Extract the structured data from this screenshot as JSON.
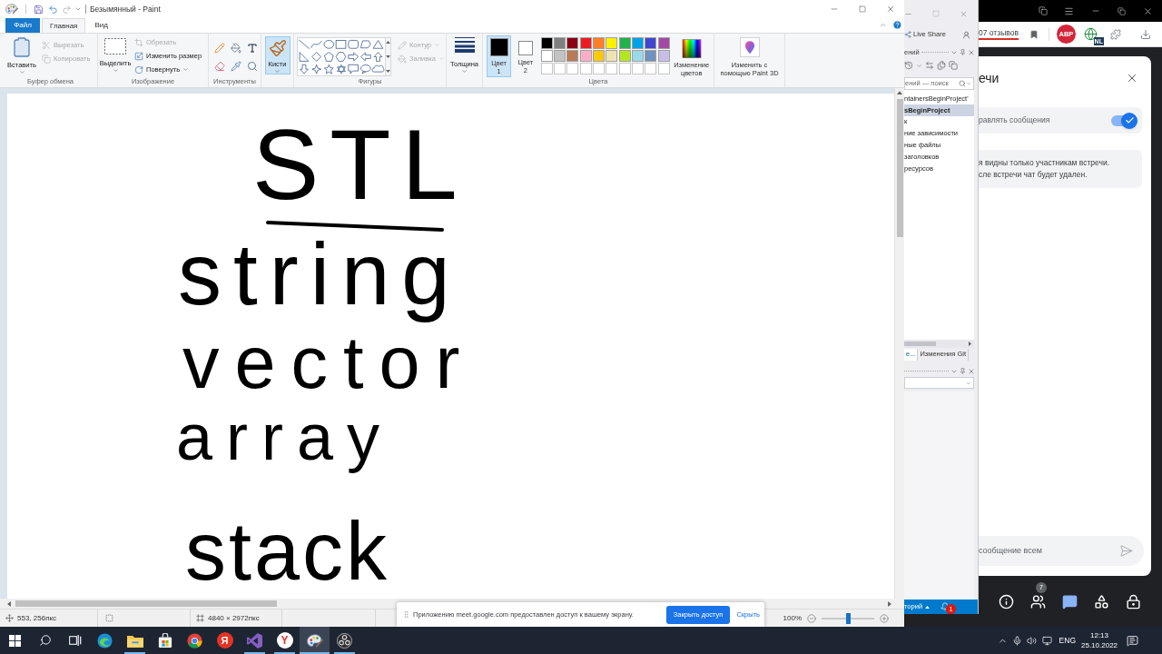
{
  "paint": {
    "title": "Безымянный - Paint",
    "tabs": [
      {
        "label": "Файл",
        "kind": "file",
        "selected": false
      },
      {
        "label": "Главная",
        "kind": "tab",
        "selected": true
      },
      {
        "label": "Вид",
        "kind": "tab",
        "selected": false
      }
    ],
    "ribbon": {
      "clipboard": {
        "label": "Буфер обмена",
        "paste": "Вставить",
        "items": [
          {
            "label": "Вырезать",
            "kind": "cut",
            "disabled": true
          },
          {
            "label": "Копировать",
            "kind": "copy",
            "disabled": true
          }
        ]
      },
      "image": {
        "label": "Изображение",
        "select": "Выделить",
        "items": [
          {
            "label": "Обрезать",
            "kind": "crop",
            "disabled": true
          },
          {
            "label": "Изменить размер",
            "kind": "resize",
            "disabled": false
          },
          {
            "label": "Повернуть",
            "kind": "rotate",
            "disabled": false
          }
        ]
      },
      "tools": {
        "label": "Инструменты"
      },
      "brushes": {
        "label": "Кисти",
        "selected": true
      },
      "shapes": {
        "label": "Фигуры",
        "items": [
          {
            "label": "Контур",
            "kind": "outline",
            "disabled": true
          },
          {
            "label": "Заливка",
            "kind": "fill",
            "disabled": true
          }
        ]
      },
      "size": {
        "label": "Толщина"
      },
      "colors": {
        "label": "Цвета",
        "current": [
          {
            "label": "Цвет 1",
            "color": "#000000",
            "selected": true
          },
          {
            "label": "Цвет 2",
            "color": "#ffffff",
            "selected": false
          }
        ],
        "palette": [
          {
            "kind": "color",
            "color": "#000000"
          },
          {
            "kind": "color",
            "color": "#7f7f7f"
          },
          {
            "kind": "color",
            "color": "#880015"
          },
          {
            "kind": "color",
            "color": "#ed1c24"
          },
          {
            "kind": "color",
            "color": "#ff7f27"
          },
          {
            "kind": "color",
            "color": "#fff200"
          },
          {
            "kind": "color",
            "color": "#22b14c"
          },
          {
            "kind": "color",
            "color": "#00a2e8"
          },
          {
            "kind": "color",
            "color": "#3f48cc"
          },
          {
            "kind": "color",
            "color": "#a349a4"
          },
          {
            "kind": "color",
            "color": "#ffffff"
          },
          {
            "kind": "color",
            "color": "#c3c3c3"
          },
          {
            "kind": "color",
            "color": "#b97a57"
          },
          {
            "kind": "color",
            "color": "#ffaec9"
          },
          {
            "kind": "color",
            "color": "#ffc90e"
          },
          {
            "kind": "color",
            "color": "#efe4b0"
          },
          {
            "kind": "color",
            "color": "#b5e61d"
          },
          {
            "kind": "color",
            "color": "#99d9ea"
          },
          {
            "kind": "color",
            "color": "#7092be"
          },
          {
            "kind": "color",
            "color": "#c8bfe7"
          },
          {
            "kind": "empty"
          },
          {
            "kind": "empty"
          },
          {
            "kind": "empty"
          },
          {
            "kind": "empty"
          },
          {
            "kind": "empty"
          },
          {
            "kind": "empty"
          },
          {
            "kind": "empty"
          },
          {
            "kind": "empty"
          },
          {
            "kind": "empty"
          },
          {
            "kind": "empty"
          }
        ],
        "edit": "Изменение цветов"
      },
      "paint3d": "Изменить с помощью Paint 3D"
    },
    "canvas": {
      "lines": [
        {
          "text": "STL",
          "kind": "heading"
        },
        {
          "text": "string",
          "kind": "word"
        },
        {
          "text": "vector",
          "kind": "word"
        },
        {
          "text": "array",
          "kind": "word"
        },
        {
          "text": "stack",
          "kind": "word"
        }
      ]
    },
    "status_bar": {
      "cursor": "553, 256пкс",
      "canvas_size": "4840 × 2972пкс",
      "zoom": {
        "reading": "100%",
        "level": 0.5
      }
    }
  },
  "share_notice": {
    "text": "Приложению meet.google.com предоставлен доступ к вашему экрану.",
    "stop_button": "Закрыть доступ",
    "hide_link": "Скрыть"
  },
  "visual_studio": {
    "live_share": "Live Share",
    "solution_explorer": {
      "title": "ений",
      "search": {
        "placeholder": "ений — поиск"
      },
      "tree": [
        {
          "label": "ntainersBeginProject'",
          "selected": false,
          "children": [
            {
              "label": "sBeginProject",
              "selected": true,
              "children": [
                {
                  "label": "к",
                  "selected": false
                },
                {
                  "label": "ние зависимости",
                  "selected": false
                },
                {
                  "label": "ные файлы",
                  "selected": false
                },
                {
                  "label": "заголовков",
                  "selected": false
                },
                {
                  "label": "ресурсов",
                  "selected": false
                }
              ]
            }
          ]
        }
      ]
    },
    "tabs": [
      {
        "label": "е...",
        "selected": true
      },
      {
        "label": "Изменения Git",
        "selected": false
      }
    ],
    "status_bar": {
      "branch": "торий",
      "notifications": "1"
    }
  },
  "meet": {
    "toolbar_link": "07 отзывов",
    "extensions": [
      {
        "kind": "abp",
        "label": "ABP"
      },
      {
        "kind": "translate",
        "label": "NL"
      }
    ],
    "chat": {
      "title": "ечи",
      "toggle": {
        "label": "равлять сообщения",
        "on": true
      },
      "notice": [
        "я видны только участникам встречи.",
        "сле встречи чат будет удален."
      ],
      "input": {
        "placeholder": "сообщение всем"
      }
    },
    "controls": [
      {
        "kind": "info",
        "selected": false
      },
      {
        "kind": "people",
        "selected": false,
        "badge": "7"
      },
      {
        "kind": "chat",
        "selected": true
      },
      {
        "kind": "activities",
        "selected": false
      },
      {
        "kind": "host",
        "selected": false
      }
    ]
  },
  "taskbar": {
    "apps": [
      {
        "kind": "edge",
        "running": false,
        "selected": false
      },
      {
        "kind": "explorer",
        "running": true,
        "selected": false
      },
      {
        "kind": "store",
        "running": false,
        "selected": false
      },
      {
        "kind": "chrome",
        "running": false,
        "selected": false
      },
      {
        "kind": "yandex",
        "label": "Я",
        "running": false,
        "selected": false
      },
      {
        "kind": "vs",
        "running": true,
        "selected": false
      },
      {
        "kind": "yandex_browser",
        "label": "Y",
        "running": true,
        "selected": false
      },
      {
        "kind": "paint",
        "running": true,
        "selected": true
      },
      {
        "kind": "obs",
        "running": true,
        "selected": false
      }
    ],
    "language": "ENG",
    "time": "12:13",
    "date": "25.10.2022"
  }
}
